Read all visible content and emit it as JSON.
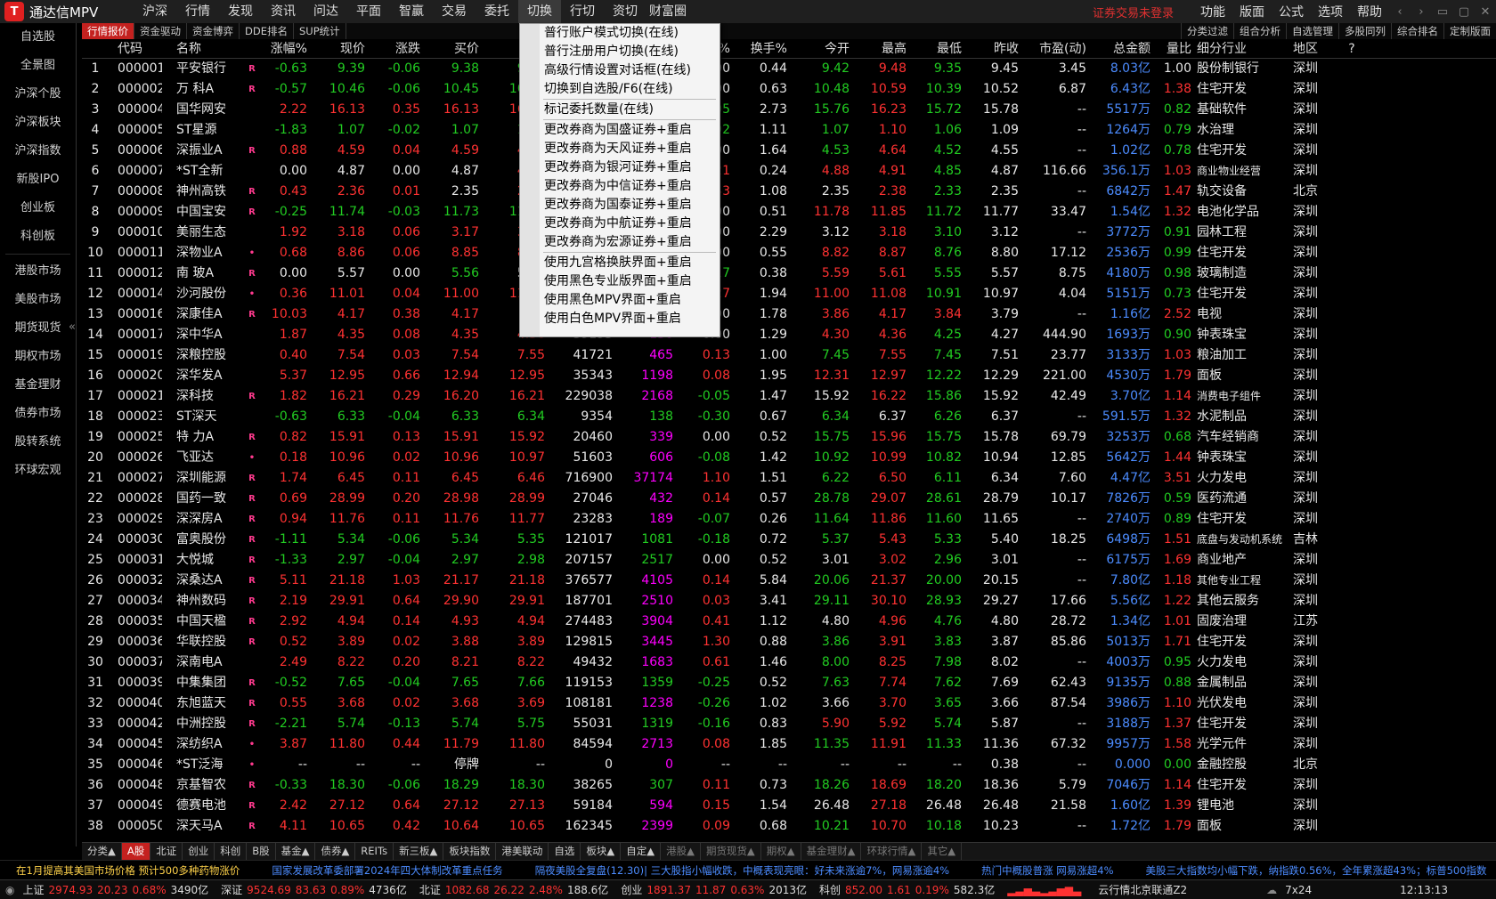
{
  "app": {
    "title": "通达信MPV",
    "logo_glyph": "T"
  },
  "menu": [
    "沪深",
    "行情",
    "发现",
    "资讯",
    "问达",
    "平面",
    "智赢",
    "交易",
    "委托",
    "切换",
    "行切",
    "资切",
    "财富圈"
  ],
  "active_menu": "切换",
  "top_right": {
    "login_warning": "证券交易未登录",
    "items": [
      "功能",
      "版面",
      "公式",
      "选项",
      "帮助"
    ],
    "win_buttons": [
      "‹",
      "›",
      "▭",
      "▢",
      "✕"
    ]
  },
  "sidebar": [
    "自选股",
    "全景图",
    "沪深个股",
    "沪深板块",
    "沪深指数",
    "新股IPO",
    "创业板",
    "科创板",
    "港股市场",
    "美股市场",
    "期货现货",
    "期权市场",
    "基金理财",
    "债券市场",
    "股转系统",
    "环球宏观"
  ],
  "sidebar_collapse": "«",
  "subtabs": [
    "行情报价",
    "资金驱动",
    "资金博弈",
    "DDE排名",
    "SUP统计"
  ],
  "subtabs_right": [
    "分类过滤",
    "组合分析",
    "自选管理",
    "多股同列",
    "综合排名",
    "定制版面"
  ],
  "headers": [
    "",
    "代码",
    "名称",
    "",
    "涨幅%",
    "现价",
    "涨跌",
    "买价",
    "卖价",
    "总量",
    "现量",
    "涨速%",
    "换手%",
    "今开",
    "最高",
    "最低",
    "昨收",
    "市盈(动)",
    "总金额",
    "量比",
    "细分行业",
    "地区",
    "?"
  ],
  "rows": [
    [
      "1",
      "000001",
      "平安银行",
      "R",
      "-0.63",
      "9.39",
      "-0.06",
      "9.38",
      "9.39",
      "",
      "",
      "0.00",
      "0.44",
      "9.42",
      "9.48",
      "9.35",
      "9.45",
      "3.45",
      "8.03亿",
      "1.00",
      "股份制银行",
      "深圳"
    ],
    [
      "2",
      "000002",
      "万 科A",
      "R",
      "-0.57",
      "10.46",
      "-0.06",
      "10.45",
      "10.46",
      "",
      "",
      "0.00",
      "0.63",
      "10.48",
      "10.59",
      "10.39",
      "10.52",
      "6.87",
      "6.43亿",
      "1.38",
      "住宅开发",
      "深圳"
    ],
    [
      "3",
      "000004",
      "国华网安",
      "",
      "2.22",
      "16.13",
      "0.35",
      "16.13",
      "16.14",
      "",
      "",
      "-0.05",
      "2.73",
      "15.76",
      "16.23",
      "15.72",
      "15.78",
      "--",
      "5517万",
      "0.82",
      "基础软件",
      "深圳"
    ],
    [
      "4",
      "000005",
      "ST星源",
      "",
      "-1.83",
      "1.07",
      "-0.02",
      "1.07",
      "1.08",
      "",
      "",
      "-0.92",
      "1.11",
      "1.07",
      "1.10",
      "1.06",
      "1.09",
      "--",
      "1264万",
      "0.79",
      "水治理",
      "深圳"
    ],
    [
      "5",
      "000006",
      "深振业A",
      "R",
      "0.88",
      "4.59",
      "0.04",
      "4.59",
      "4.60",
      "",
      "",
      "0.00",
      "1.64",
      "4.53",
      "4.64",
      "4.52",
      "4.55",
      "--",
      "1.02亿",
      "0.78",
      "住宅开发",
      "深圳"
    ],
    [
      "6",
      "000007",
      "*ST全新",
      "",
      "0.00",
      "4.87",
      "0.00",
      "4.87",
      "4.88",
      "",
      "",
      "0.21",
      "0.24",
      "4.88",
      "4.91",
      "4.85",
      "4.87",
      "116.66",
      "356.1万",
      "1.03",
      "商业物业经营",
      "深圳"
    ],
    [
      "7",
      "000008",
      "神州高铁",
      "R",
      "0.43",
      "2.36",
      "0.01",
      "2.35",
      "2.36",
      "",
      "",
      "0.43",
      "1.08",
      "2.35",
      "2.38",
      "2.33",
      "2.35",
      "--",
      "6842万",
      "1.47",
      "轨交设备",
      "北京"
    ],
    [
      "8",
      "000009",
      "中国宝安",
      "R",
      "-0.25",
      "11.74",
      "-0.03",
      "11.73",
      "11.74",
      "",
      "",
      "0.00",
      "0.51",
      "11.78",
      "11.85",
      "11.72",
      "11.77",
      "33.47",
      "1.54亿",
      "1.32",
      "电池化学品",
      "深圳"
    ],
    [
      "9",
      "000010",
      "美丽生态",
      "",
      "1.92",
      "3.18",
      "0.06",
      "3.17",
      "3.18",
      "",
      "",
      "0.00",
      "2.29",
      "3.12",
      "3.18",
      "3.10",
      "3.12",
      "--",
      "3772万",
      "0.91",
      "园林工程",
      "深圳"
    ],
    [
      "10",
      "000011",
      "深物业A",
      "•",
      "0.68",
      "8.86",
      "0.06",
      "8.85",
      "8.86",
      "",
      "",
      "0.00",
      "0.55",
      "8.82",
      "8.87",
      "8.76",
      "8.80",
      "17.12",
      "2536万",
      "0.99",
      "住宅开发",
      "深圳"
    ],
    [
      "11",
      "000012",
      "南 玻A",
      "R",
      "0.00",
      "5.57",
      "0.00",
      "5.56",
      "5.57",
      "",
      "",
      "-0.17",
      "0.38",
      "5.59",
      "5.61",
      "5.55",
      "5.57",
      "8.75",
      "4180万",
      "0.98",
      "玻璃制造",
      "深圳"
    ],
    [
      "12",
      "000014",
      "沙河股份",
      "•",
      "0.36",
      "11.01",
      "0.04",
      "11.00",
      "11.01",
      "",
      "",
      "0.27",
      "1.94",
      "11.00",
      "11.08",
      "10.91",
      "10.97",
      "4.04",
      "5151万",
      "0.73",
      "住宅开发",
      "深圳"
    ],
    [
      "13",
      "000016",
      "深康佳A",
      "R",
      "10.03",
      "4.17",
      "0.38",
      "4.17",
      "--",
      "",
      "",
      "0.00",
      "1.78",
      "3.86",
      "4.17",
      "3.84",
      "3.79",
      "--",
      "1.16亿",
      "2.52",
      "电视",
      "深圳"
    ],
    [
      "14",
      "000017",
      "深中华A",
      "",
      "1.87",
      "4.35",
      "0.08",
      "4.35",
      "4.36",
      "39195",
      "130",
      "0.00",
      "1.29",
      "4.30",
      "4.36",
      "4.25",
      "4.27",
      "444.90",
      "1693万",
      "0.90",
      "钟表珠宝",
      "深圳"
    ],
    [
      "15",
      "000019",
      "深粮控股",
      "",
      "0.40",
      "7.54",
      "0.03",
      "7.54",
      "7.55",
      "41721",
      "465",
      "0.13",
      "1.00",
      "7.45",
      "7.55",
      "7.45",
      "7.51",
      "23.77",
      "3133万",
      "1.03",
      "粮油加工",
      "深圳"
    ],
    [
      "16",
      "000020",
      "深华发A",
      "",
      "5.37",
      "12.95",
      "0.66",
      "12.94",
      "12.95",
      "35343",
      "1198",
      "0.08",
      "1.95",
      "12.31",
      "12.97",
      "12.22",
      "12.29",
      "221.00",
      "4530万",
      "1.79",
      "面板",
      "深圳"
    ],
    [
      "17",
      "000021",
      "深科技",
      "R",
      "1.82",
      "16.21",
      "0.29",
      "16.20",
      "16.21",
      "229038",
      "2168",
      "-0.05",
      "1.47",
      "15.92",
      "16.22",
      "15.86",
      "15.92",
      "42.49",
      "3.70亿",
      "1.14",
      "消费电子组件",
      "深圳"
    ],
    [
      "18",
      "000023",
      "ST深天",
      "",
      "-0.63",
      "6.33",
      "-0.04",
      "6.33",
      "6.34",
      "9354",
      "138",
      "-0.30",
      "0.67",
      "6.34",
      "6.37",
      "6.26",
      "6.37",
      "--",
      "591.5万",
      "1.32",
      "水泥制品",
      "深圳"
    ],
    [
      "19",
      "000025",
      "特 力A",
      "R",
      "0.82",
      "15.91",
      "0.13",
      "15.91",
      "15.92",
      "20460",
      "339",
      "0.00",
      "0.52",
      "15.75",
      "15.96",
      "15.75",
      "15.78",
      "69.79",
      "3253万",
      "0.68",
      "汽车经销商",
      "深圳"
    ],
    [
      "20",
      "000026",
      "飞亚达",
      "•",
      "0.18",
      "10.96",
      "0.02",
      "10.96",
      "10.97",
      "51603",
      "606",
      "-0.08",
      "1.42",
      "10.92",
      "10.99",
      "10.82",
      "10.94",
      "12.85",
      "5642万",
      "1.44",
      "钟表珠宝",
      "深圳"
    ],
    [
      "21",
      "000027",
      "深圳能源",
      "R",
      "1.74",
      "6.45",
      "0.11",
      "6.45",
      "6.46",
      "716900",
      "37174",
      "1.10",
      "1.51",
      "6.22",
      "6.50",
      "6.11",
      "6.34",
      "7.60",
      "4.47亿",
      "3.51",
      "火力发电",
      "深圳"
    ],
    [
      "22",
      "000028",
      "国药一致",
      "R",
      "0.69",
      "28.99",
      "0.20",
      "28.98",
      "28.99",
      "27046",
      "432",
      "0.14",
      "0.57",
      "28.78",
      "29.07",
      "28.61",
      "28.79",
      "10.17",
      "7826万",
      "0.59",
      "医药流通",
      "深圳"
    ],
    [
      "23",
      "000029",
      "深深房A",
      "R",
      "0.94",
      "11.76",
      "0.11",
      "11.76",
      "11.77",
      "23283",
      "189",
      "-0.07",
      "0.26",
      "11.64",
      "11.86",
      "11.60",
      "11.65",
      "--",
      "2740万",
      "0.89",
      "住宅开发",
      "深圳"
    ],
    [
      "24",
      "000030",
      "富奥股份",
      "R",
      "-1.11",
      "5.34",
      "-0.06",
      "5.34",
      "5.35",
      "121017",
      "1081",
      "-0.18",
      "0.72",
      "5.37",
      "5.43",
      "5.33",
      "5.40",
      "18.25",
      "6498万",
      "1.51",
      "底盘与发动机系统",
      "吉林"
    ],
    [
      "25",
      "000031",
      "大悦城",
      "R",
      "-1.33",
      "2.97",
      "-0.04",
      "2.97",
      "2.98",
      "207157",
      "2517",
      "0.00",
      "0.52",
      "3.01",
      "3.02",
      "2.96",
      "3.01",
      "--",
      "6175万",
      "1.69",
      "商业地产",
      "深圳"
    ],
    [
      "26",
      "000032",
      "深桑达A",
      "R",
      "5.11",
      "21.18",
      "1.03",
      "21.17",
      "21.18",
      "376577",
      "4105",
      "0.14",
      "5.84",
      "20.06",
      "21.37",
      "20.00",
      "20.15",
      "--",
      "7.80亿",
      "1.18",
      "其他专业工程",
      "深圳"
    ],
    [
      "27",
      "000034",
      "神州数码",
      "R",
      "2.19",
      "29.91",
      "0.64",
      "29.90",
      "29.91",
      "187701",
      "2510",
      "0.03",
      "3.41",
      "29.11",
      "30.10",
      "28.93",
      "29.27",
      "17.66",
      "5.56亿",
      "1.22",
      "其他云服务",
      "深圳"
    ],
    [
      "28",
      "000035",
      "中国天楹",
      "R",
      "2.92",
      "4.94",
      "0.14",
      "4.93",
      "4.94",
      "274483",
      "3904",
      "0.41",
      "1.12",
      "4.80",
      "4.96",
      "4.76",
      "4.80",
      "28.72",
      "1.34亿",
      "1.01",
      "固废治理",
      "江苏"
    ],
    [
      "29",
      "000036",
      "华联控股",
      "R",
      "0.52",
      "3.89",
      "0.02",
      "3.88",
      "3.89",
      "129815",
      "3445",
      "1.30",
      "0.88",
      "3.86",
      "3.91",
      "3.83",
      "3.87",
      "85.86",
      "5013万",
      "1.71",
      "住宅开发",
      "深圳"
    ],
    [
      "30",
      "000037",
      "深南电A",
      "",
      "2.49",
      "8.22",
      "0.20",
      "8.21",
      "8.22",
      "49432",
      "1683",
      "0.61",
      "1.46",
      "8.00",
      "8.25",
      "7.98",
      "8.02",
      "--",
      "4003万",
      "0.95",
      "火力发电",
      "深圳"
    ],
    [
      "31",
      "000039",
      "中集集团",
      "R",
      "-0.52",
      "7.65",
      "-0.04",
      "7.65",
      "7.66",
      "119153",
      "1359",
      "-0.25",
      "0.52",
      "7.63",
      "7.74",
      "7.62",
      "7.69",
      "62.43",
      "9135万",
      "0.88",
      "金属制品",
      "深圳"
    ],
    [
      "32",
      "000040",
      "东旭蓝天",
      "R",
      "0.55",
      "3.68",
      "0.02",
      "3.68",
      "3.69",
      "108181",
      "1238",
      "-0.26",
      "1.02",
      "3.66",
      "3.70",
      "3.65",
      "3.66",
      "87.54",
      "3986万",
      "1.10",
      "光伏发电",
      "深圳"
    ],
    [
      "33",
      "000042",
      "中洲控股",
      "R",
      "-2.21",
      "5.74",
      "-0.13",
      "5.74",
      "5.75",
      "55031",
      "1319",
      "-0.16",
      "0.83",
      "5.90",
      "5.92",
      "5.74",
      "5.87",
      "--",
      "3188万",
      "1.37",
      "住宅开发",
      "深圳"
    ],
    [
      "34",
      "000045",
      "深纺织A",
      "•",
      "3.87",
      "11.80",
      "0.44",
      "11.79",
      "11.80",
      "84594",
      "2713",
      "0.08",
      "1.85",
      "11.35",
      "11.91",
      "11.33",
      "11.36",
      "67.32",
      "9957万",
      "1.58",
      "光学元件",
      "深圳"
    ],
    [
      "35",
      "000046",
      "*ST泛海",
      "•",
      "--",
      "--",
      "--",
      "停牌",
      "--",
      "0",
      "0",
      "--",
      "--",
      "--",
      "--",
      "--",
      "0.38",
      "--",
      "0.000",
      "0.00",
      "金融控股",
      "北京"
    ],
    [
      "36",
      "000048",
      "京基智农",
      "R",
      "-0.33",
      "18.30",
      "-0.06",
      "18.29",
      "18.30",
      "38265",
      "307",
      "0.11",
      "0.73",
      "18.26",
      "18.69",
      "18.20",
      "18.36",
      "5.79",
      "7046万",
      "1.14",
      "住宅开发",
      "深圳"
    ],
    [
      "37",
      "000049",
      "德赛电池",
      "R",
      "2.42",
      "27.12",
      "0.64",
      "27.12",
      "27.13",
      "59184",
      "594",
      "0.15",
      "1.54",
      "26.48",
      "27.18",
      "26.48",
      "26.48",
      "21.58",
      "1.60亿",
      "1.39",
      "锂电池",
      "深圳"
    ],
    [
      "38",
      "000050",
      "深天马A",
      "R",
      "4.11",
      "10.65",
      "0.42",
      "10.64",
      "10.65",
      "162345",
      "2399",
      "0.09",
      "0.68",
      "10.21",
      "10.70",
      "10.18",
      "10.23",
      "--",
      "1.72亿",
      "1.79",
      "面板",
      "深圳"
    ]
  ],
  "dropdown": [
    {
      "label": "普行账户模式切换(在线)"
    },
    {
      "label": "普行注册用户切换(在线)"
    },
    {
      "label": "高级行情设置对话框(在线)"
    },
    {
      "label": "切换到自选股/F6(在线)"
    },
    {
      "sep": true
    },
    {
      "label": "标记委托数量(在线)"
    },
    {
      "sep": true
    },
    {
      "label": "更改券商为国盛证券+重启"
    },
    {
      "label": "更改券商为天风证券+重启"
    },
    {
      "label": "更改券商为银河证券+重启"
    },
    {
      "label": "更改券商为中信证券+重启"
    },
    {
      "label": "更改券商为国泰证券+重启"
    },
    {
      "label": "更改券商为中航证券+重启"
    },
    {
      "label": "更改券商为宏源证券+重启"
    },
    {
      "sep": true
    },
    {
      "label": "使用九宫格换肤界面+重启"
    },
    {
      "label": "使用黑色专业版界面+重启"
    },
    {
      "label": "使用黑色MPV界面+重启"
    },
    {
      "label": "使用白色MPV界面+重启"
    }
  ],
  "bottom_tabs": [
    {
      "label": "分类▲",
      "dim": false
    },
    {
      "label": "A股",
      "active": true
    },
    {
      "label": "北证"
    },
    {
      "label": "创业"
    },
    {
      "label": "科创"
    },
    {
      "label": "B股"
    },
    {
      "label": "基金▲"
    },
    {
      "label": "债券▲"
    },
    {
      "label": "REITs"
    },
    {
      "label": "新三板▲"
    },
    {
      "label": "板块指数"
    },
    {
      "label": "港美联动"
    },
    {
      "label": "自选"
    },
    {
      "label": "板块▲"
    },
    {
      "label": "自定▲"
    },
    {
      "label": "港股▲",
      "dim": true
    },
    {
      "label": "期货现货▲",
      "dim": true
    },
    {
      "label": "期权▲",
      "dim": true
    },
    {
      "label": "基金理财▲",
      "dim": true
    },
    {
      "label": "环球行情▲",
      "dim": true
    },
    {
      "label": "其它▲",
      "dim": true
    }
  ],
  "ticker": [
    {
      "text": "在1月提高其美国市场价格 预计500多种药物涨价",
      "color": "#ffd24a"
    },
    {
      "text": "国家发展改革委部署2024年四大体制改革重点任务",
      "color": "#4c8cff"
    },
    {
      "text": "隔夜美股全复盘(12.30)| 三大股指小幅收跌，中概表现亮眼：好未来涨逾7%，网易涨逾4%",
      "color": "#4c8cff"
    },
    {
      "text": "热门中概股普涨 网易涨超4%",
      "color": "#4c8cff"
    },
    {
      "text": "美股三大指数均小幅下跌，纳指跌0.56%，全年累涨超43%；标普500指数",
      "color": "#4c8cff"
    }
  ],
  "status": [
    {
      "label": "上证",
      "val": "2974.93",
      "chg": "20.23",
      "pct": "0.68%",
      "amt": "3490亿"
    },
    {
      "label": "深证",
      "val": "9524.69",
      "chg": "83.63",
      "pct": "0.89%",
      "amt": "4736亿"
    },
    {
      "label": "北证",
      "val": "1082.68",
      "chg": "26.22",
      "pct": "2.48%",
      "amt": "188.6亿"
    },
    {
      "label": "创业",
      "val": "1891.37",
      "chg": "11.87",
      "pct": "0.63%",
      "amt": "2013亿"
    },
    {
      "label": "科创",
      "val": "852.00",
      "chg": "1.61",
      "pct": "0.19%",
      "amt": "582.3亿"
    }
  ],
  "status_right": {
    "server": "云行情北京联通Z2",
    "mode": "7x24",
    "time": "12:13:13"
  },
  "colors": {
    "up": "#ff3232",
    "down": "#22cc22",
    "accent": "#c4211f"
  }
}
